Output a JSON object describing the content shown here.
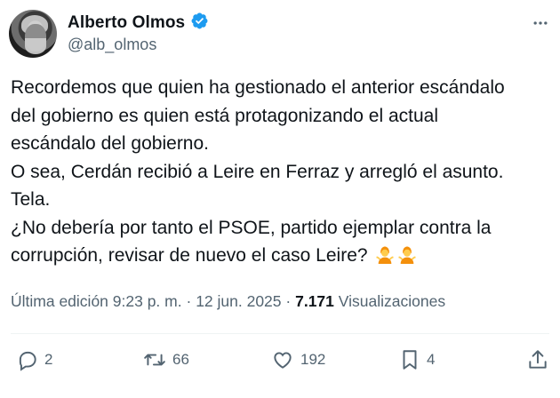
{
  "author": {
    "name": "Alberto Olmos",
    "handle": "@alb_olmos",
    "verified": true,
    "accent_color": "#1d9bf0"
  },
  "tweet": {
    "lines": [
      "Recordemos que quien ha gestionado el anterior escándalo",
      "del gobierno es quien está protagonizando el actual",
      "escándalo del gobierno.",
      "O sea, Cerdán recibió a Leire en Ferraz y arregló el asunto.",
      "Tela.",
      "¿No debería por tanto el PSOE, partido ejemplar contra la",
      "corrupción, revisar de nuevo el caso Leire?"
    ],
    "emojis": [
      "person-shrugging-emoji",
      "person-shrugging-emoji"
    ]
  },
  "meta": {
    "edited_label": "Última edición",
    "time": "9:23 p. m.",
    "sep1": "·",
    "date": "12 jun. 2025",
    "sep2": "·",
    "views_count": "7.171",
    "views_label": "Visualizaciones"
  },
  "actions": {
    "reply_count": "2",
    "retweet_count": "66",
    "like_count": "192",
    "bookmark_count": "4"
  },
  "colors": {
    "text": "#0f1419",
    "secondary": "#536471",
    "divider": "#eff3f4"
  }
}
